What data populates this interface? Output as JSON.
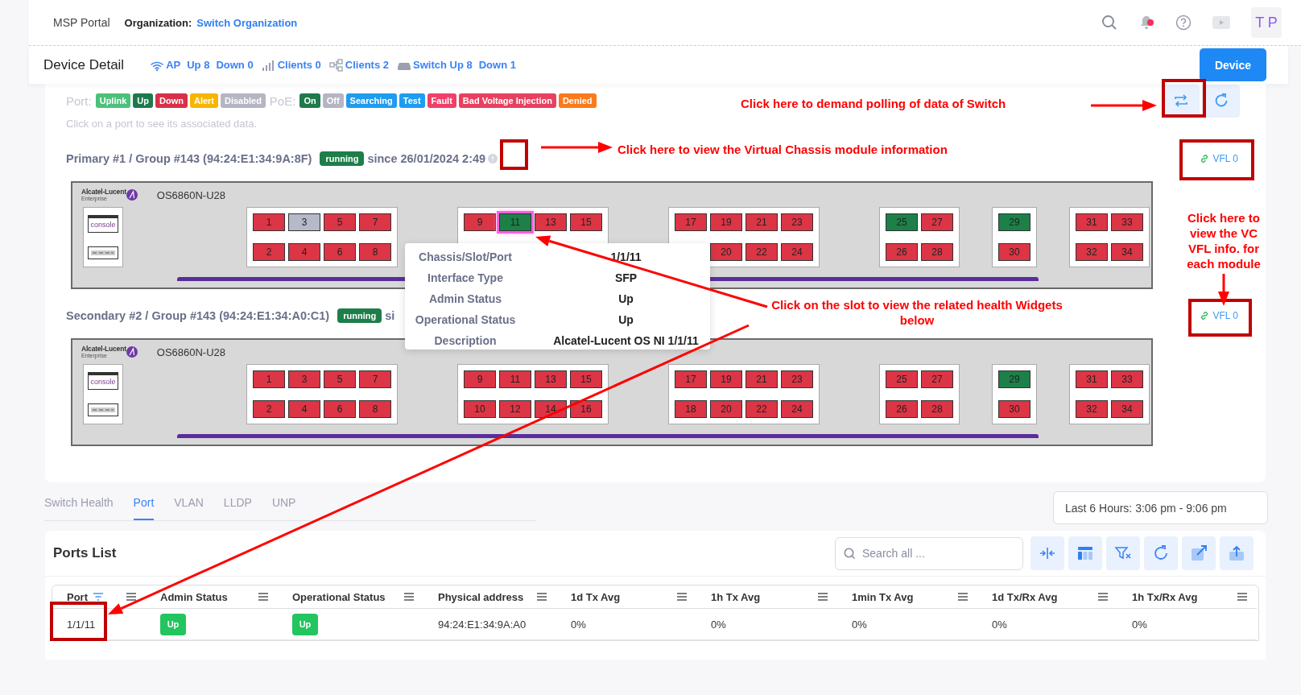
{
  "header": {
    "portal": "MSP Portal",
    "org_label": "Organization:",
    "org_name": "Switch Organization",
    "notification": true,
    "avatar": "T P"
  },
  "detail_bar": {
    "title": "Device Detail",
    "stats": [
      {
        "kind": "wifi",
        "parts": [
          "AP",
          "Up 8",
          "Down 0"
        ]
      },
      {
        "kind": "signal",
        "parts": [
          "Clients 0"
        ]
      },
      {
        "kind": "nodes",
        "parts": [
          "Clients 2"
        ]
      },
      {
        "kind": "switch",
        "parts": [
          "Switch Up 8",
          "Down 1"
        ]
      }
    ],
    "button": "Device"
  },
  "legend": {
    "port_label": "Port:",
    "port_states": [
      {
        "label": "Uplink",
        "color": "#4cc17a"
      },
      {
        "label": "Up",
        "color": "#1e7a4b"
      },
      {
        "label": "Down",
        "color": "#d9304a"
      },
      {
        "label": "Alert",
        "color": "#f7b500"
      },
      {
        "label": "Disabled",
        "color": "#b5b5c3"
      }
    ],
    "poe_label": "PoE:",
    "poe_states": [
      {
        "label": "On",
        "color": "#1e7a4b"
      },
      {
        "label": "Off",
        "color": "#b5b5c3"
      },
      {
        "label": "Searching",
        "color": "#1e9cf0"
      },
      {
        "label": "Test",
        "color": "#1e9cf0"
      },
      {
        "label": "Fault",
        "color": "#f0406a"
      },
      {
        "label": "Bad Voltage Injection",
        "color": "#e8405f"
      },
      {
        "label": "Denied",
        "color": "#fb7a1c"
      }
    ],
    "hint": "Click on a port to see its associated data."
  },
  "modules": [
    {
      "title": "Primary #1 / Group #143 (94:24:E1:34:9A:8F)",
      "status": "running",
      "since": "since 26/01/2024 2:49",
      "info_icon": true,
      "vfl": "VFL 0",
      "chassis": {
        "brand": "Alcatel-Lucent",
        "brand_sub": "Enterprise",
        "model": "OS6860N-U28",
        "console": "console",
        "groups": [
          {
            "top": [
              {
                "label": "1",
                "color": "#dc3545",
                "selected": false
              },
              {
                "label": "3",
                "color": "#b6b9c8",
                "selected": false
              },
              {
                "label": "5",
                "color": "#dc3545",
                "selected": false
              },
              {
                "label": "7",
                "color": "#dc3545",
                "selected": false
              }
            ],
            "bottom": [
              {
                "label": "2",
                "color": "#dc3545",
                "selected": false
              },
              {
                "label": "4",
                "color": "#dc3545",
                "selected": false
              },
              {
                "label": "6",
                "color": "#dc3545",
                "selected": false
              },
              {
                "label": "8",
                "color": "#dc3545",
                "selected": false
              }
            ]
          },
          {
            "top": [
              {
                "label": "9",
                "color": "#dc3545",
                "selected": false
              },
              {
                "label": "11",
                "color": "#1d8049",
                "selected": true
              },
              {
                "label": "13",
                "color": "#dc3545",
                "selected": false
              },
              {
                "label": "15",
                "color": "#dc3545",
                "selected": false
              }
            ]
          },
          {
            "top": [
              {
                "label": "17",
                "color": "#dc3545",
                "selected": false
              },
              {
                "label": "19",
                "color": "#dc3545",
                "selected": false
              },
              {
                "label": "21",
                "color": "#dc3545",
                "selected": false
              },
              {
                "label": "23",
                "color": "#dc3545",
                "selected": false
              }
            ],
            "bottom": [
              {
                "label": "20",
                "color": "#dc3545",
                "selected": false
              },
              {
                "label": "22",
                "color": "#dc3545",
                "selected": false
              },
              {
                "label": "24",
                "color": "#dc3545",
                "selected": false
              }
            ]
          },
          {
            "top": [
              {
                "label": "25",
                "color": "#1d8049",
                "selected": false
              },
              {
                "label": "27",
                "color": "#dc3545",
                "selected": false
              }
            ],
            "bottom": [
              {
                "label": "26",
                "color": "#dc3545",
                "selected": false
              },
              {
                "label": "28",
                "color": "#dc3545",
                "selected": false
              }
            ]
          },
          {
            "top": [
              {
                "label": "29",
                "color": "#1d8049",
                "selected": false
              }
            ],
            "bottom": [
              {
                "label": "30",
                "color": "#dc3545",
                "selected": false
              }
            ]
          },
          {
            "top": [
              {
                "label": "31",
                "color": "#dc3545",
                "selected": false
              },
              {
                "label": "33",
                "color": "#dc3545",
                "selected": false
              }
            ],
            "bottom": [
              {
                "label": "32",
                "color": "#dc3545",
                "selected": false
              },
              {
                "label": "34",
                "color": "#dc3545",
                "selected": false
              }
            ]
          }
        ]
      }
    },
    {
      "title": "Secondary #2 / Group #143 (94:24:E1:34:A0:C1)",
      "status": "running",
      "since": "si",
      "info_icon": false,
      "vfl": "VFL 0",
      "chassis": {
        "brand": "Alcatel-Lucent",
        "brand_sub": "Enterprise",
        "model": "OS6860N-U28",
        "console": "console",
        "groups": [
          {
            "top": [
              {
                "label": "1",
                "color": "#dc3545",
                "selected": false
              },
              {
                "label": "3",
                "color": "#dc3545",
                "selected": false
              },
              {
                "label": "5",
                "color": "#dc3545",
                "selected": false
              },
              {
                "label": "7",
                "color": "#dc3545",
                "selected": false
              }
            ],
            "bottom": [
              {
                "label": "2",
                "color": "#dc3545",
                "selected": false
              },
              {
                "label": "4",
                "color": "#dc3545",
                "selected": false
              },
              {
                "label": "6",
                "color": "#dc3545",
                "selected": false
              },
              {
                "label": "8",
                "color": "#dc3545",
                "selected": false
              }
            ]
          },
          {
            "top": [
              {
                "label": "9",
                "color": "#dc3545",
                "selected": false
              },
              {
                "label": "11",
                "color": "#dc3545",
                "selected": false
              },
              {
                "label": "13",
                "color": "#dc3545",
                "selected": false
              },
              {
                "label": "15",
                "color": "#dc3545",
                "selected": false
              }
            ],
            "bottom": [
              {
                "label": "10",
                "color": "#dc3545",
                "selected": false
              },
              {
                "label": "12",
                "color": "#dc3545",
                "selected": false
              },
              {
                "label": "14",
                "color": "#dc3545",
                "selected": false
              },
              {
                "label": "16",
                "color": "#dc3545",
                "selected": false
              }
            ]
          },
          {
            "top": [
              {
                "label": "17",
                "color": "#dc3545",
                "selected": false
              },
              {
                "label": "19",
                "color": "#dc3545",
                "selected": false
              },
              {
                "label": "21",
                "color": "#dc3545",
                "selected": false
              },
              {
                "label": "23",
                "color": "#dc3545",
                "selected": false
              }
            ],
            "bottom": [
              {
                "label": "18",
                "color": "#dc3545",
                "selected": false
              },
              {
                "label": "20",
                "color": "#dc3545",
                "selected": false
              },
              {
                "label": "22",
                "color": "#dc3545",
                "selected": false
              },
              {
                "label": "24",
                "color": "#dc3545",
                "selected": false
              }
            ]
          },
          {
            "top": [
              {
                "label": "25",
                "color": "#dc3545",
                "selected": false
              },
              {
                "label": "27",
                "color": "#dc3545",
                "selected": false
              }
            ],
            "bottom": [
              {
                "label": "26",
                "color": "#dc3545",
                "selected": false
              },
              {
                "label": "28",
                "color": "#dc3545",
                "selected": false
              }
            ]
          },
          {
            "top": [
              {
                "label": "29",
                "color": "#1d8049",
                "selected": false
              }
            ],
            "bottom": [
              {
                "label": "30",
                "color": "#dc3545",
                "selected": false
              }
            ]
          },
          {
            "top": [
              {
                "label": "31",
                "color": "#dc3545",
                "selected": false
              },
              {
                "label": "33",
                "color": "#dc3545",
                "selected": false
              }
            ],
            "bottom": [
              {
                "label": "32",
                "color": "#dc3545",
                "selected": false
              },
              {
                "label": "34",
                "color": "#dc3545",
                "selected": false
              }
            ]
          }
        ]
      }
    }
  ],
  "tooltip": {
    "rows": [
      {
        "label": "Chassis/Slot/Port",
        "value": "1/1/11"
      },
      {
        "label": "Interface Type",
        "value": "SFP"
      },
      {
        "label": "Admin Status",
        "value": "Up"
      },
      {
        "label": "Operational Status",
        "value": "Up"
      },
      {
        "label": "Description",
        "value": "Alcatel-Lucent OS NI 1/1/11"
      }
    ]
  },
  "tabs": [
    {
      "label": "Switch Health",
      "selected": false
    },
    {
      "label": "Port",
      "selected": true
    },
    {
      "label": "VLAN",
      "selected": false
    },
    {
      "label": "LLDP",
      "selected": false
    },
    {
      "label": "UNP",
      "selected": false
    }
  ],
  "time_range": "Last 6 Hours: 3:06 pm - 9:06 pm",
  "ports_list": {
    "title": "Ports List",
    "search_placeholder": "Search all ...",
    "toolbar": [
      {
        "kind": "compress"
      },
      {
        "kind": "columns"
      },
      {
        "kind": "filter-clear"
      },
      {
        "kind": "refresh"
      },
      {
        "kind": "external"
      },
      {
        "kind": "upload"
      }
    ],
    "columns": [
      {
        "label": "Port",
        "filtered": true
      },
      {
        "label": "Admin Status",
        "filtered": false
      },
      {
        "label": "Operational Status",
        "filtered": false
      },
      {
        "label": "Physical address",
        "filtered": false
      },
      {
        "label": "1d Tx Avg",
        "filtered": false
      },
      {
        "label": "1h Tx Avg",
        "filtered": false
      },
      {
        "label": "1min Tx Avg",
        "filtered": false
      },
      {
        "label": "1d Tx/Rx Avg",
        "filtered": false
      },
      {
        "label": "1h Tx/Rx Avg",
        "filtered": false
      }
    ],
    "rows": [
      [
        {
          "text": "1/1/11",
          "kind": "text"
        },
        {
          "text": "Up",
          "kind": "badge"
        },
        {
          "text": "Up",
          "kind": "badge"
        },
        {
          "text": "94:24:E1:34:9A:A0",
          "kind": "text"
        },
        {
          "text": "0%",
          "kind": "text"
        },
        {
          "text": "0%",
          "kind": "text"
        },
        {
          "text": "0%",
          "kind": "text"
        },
        {
          "text": "0%",
          "kind": "text"
        },
        {
          "text": "0%",
          "kind": "text"
        }
      ]
    ]
  },
  "annotations": [
    {
      "text": "Click here to demand polling of data of Switch"
    },
    {
      "text": "Click here to view the Virtual Chassis module information"
    },
    {
      "text": "Click here to view the VC VFL info. for each module"
    },
    {
      "text": "Click on the slot to view the related health Widgets below"
    }
  ]
}
